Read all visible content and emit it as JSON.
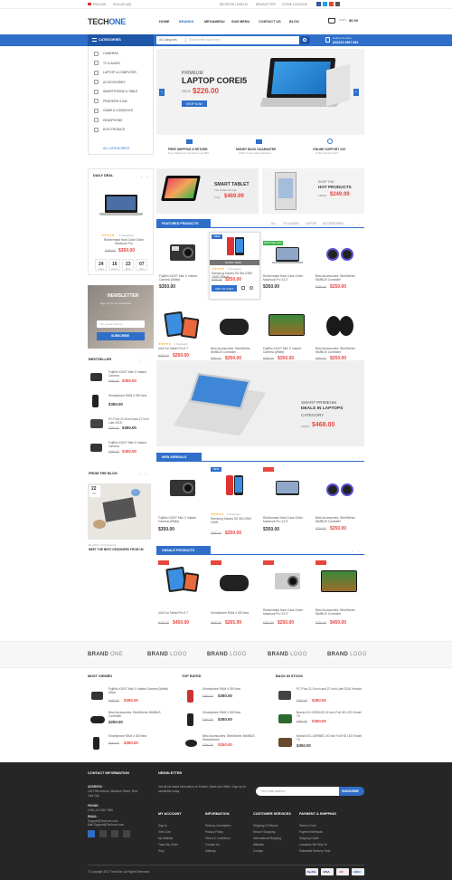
{
  "topbar": {
    "language": "ENGLISH",
    "currency": "DOLLAR (US)",
    "register": "REGISTER | SIGN IN",
    "newsletter": "NEWSLETTER",
    "location": "STORE LOCATION"
  },
  "header": {
    "logo_a": "TECH",
    "logo_b": "ONE",
    "nav": [
      "HOME",
      "BRANDS",
      "MEGAMENU",
      "SUB MENU",
      "CONTACT US",
      "BLOG"
    ],
    "cart_label": "CART",
    "cart_total": "$0.00"
  },
  "searchbar": {
    "categories_label": "CATEGORIES",
    "all_categories": "All Categories",
    "placeholder": "Search entire store here...",
    "hotline_label": "Hotline Number",
    "hotline": "(00)123 4567 891"
  },
  "sidebar_categories": {
    "items": [
      "CAMERAS",
      "TV & AUDIO",
      "LAPTOP & COMPUTER",
      "ACCESSORIES",
      "SMARTPHONE & TABLE",
      "PRINTERS & INK",
      "GAME & CONSOLES",
      "HEADPHONE",
      "ELECTRONICS"
    ],
    "all": "ALL CATEGORIES"
  },
  "hero": {
    "subtitle": "PRIMEUM",
    "title": "LAPTOP COREI5",
    "since": "SINCE",
    "price": "$226.00",
    "cta": "SHOP NOW"
  },
  "services": [
    {
      "title": "FREE SHIPPING & RETURN",
      "desc": "Free shipping on all orders over $99"
    },
    {
      "title": "MONEY BACK GUARANTEE",
      "desc": "100% money back guarantee"
    },
    {
      "title": "ONLINE SUPPORT 24/7",
      "desc": "Online Support 24/7"
    }
  ],
  "daily_deal": {
    "heading": "DAILY DEAL",
    "reviews": "1 Review(s)",
    "name": "Rubbermaid Hard Case Order Macbook Pro",
    "price": "$350.00",
    "old": "$450.00",
    "countdown": [
      {
        "v": "24",
        "l": "Days"
      },
      {
        "v": "16",
        "l": "Hours"
      },
      {
        "v": "23",
        "l": "Mins"
      },
      {
        "v": "07",
        "l": "Secs"
      }
    ]
  },
  "promo_tablet": {
    "title": "SMART TABLET",
    "sub": "The Smart of Look",
    "price_label": "From",
    "price": "$469.99"
  },
  "promo_hot": {
    "line1": "SHOP THE",
    "line2": "HOT PRODUCTS",
    "price_label": "FROM",
    "price": "$249.99"
  },
  "featured": {
    "heading": "FEATURED PRODUCTS",
    "tabs": [
      "ALL",
      "TV & AUDIO",
      "LAPTOP",
      "ACCESSORIES"
    ],
    "quick_view": "QUICK VIEW",
    "add_to_cart": "ADD TO CART",
    "reviews": "1 Review(s)",
    "row1": [
      {
        "name": "Fujifilm X100T Mini X Instant Camera (White)",
        "price": "$350.00",
        "old": ""
      },
      {
        "name": "Samsung Galaxy S5 SM-G900 16GB (Black)",
        "price": "$250.00",
        "old": "$350.00"
      },
      {
        "name": "Rubbermaid Hard Case Order Macbook Pro 13.3\"",
        "price": "$350.00",
        "old": ""
      },
      {
        "name": "Best Accessories: SteelSeries NIMBUS Controller",
        "price": "$250.00",
        "old": "$350.00"
      }
    ],
    "row2": [
      {
        "name": "UAG for Tablet Pro 9.7",
        "price": "$250.00",
        "old": "$350.00"
      },
      {
        "name": "Best Accessories: SteelSeries NIMBUS Controller",
        "price": "$250.00",
        "old": "$350.00"
      },
      {
        "name": "Fujifilm X100T Mini X Instant Camera (White)",
        "price": "$350.00",
        "old": "$450.00"
      },
      {
        "name": "Best Accessories: SteelSeries NIMBUS Controller",
        "price": "$250.00",
        "old": "$350.00"
      }
    ],
    "tags": [
      "NEW",
      "BESTSELLER"
    ]
  },
  "newsletter_box": {
    "title": "NEWSLETTER",
    "text": "Sign up for our newsletter",
    "placeholder": "Your email address",
    "button": "SUBSCRIBE"
  },
  "bestseller": {
    "heading": "BESTSELLER",
    "items": [
      {
        "name": "Fujifilm X100T Mini X Instant Camera",
        "price": "$350.00",
        "old": "$450.00"
      },
      {
        "name": "Smartphone RAM 4 GB New",
        "price": "$350.00",
        "old": ""
      },
      {
        "name": "PC Pros 21.5 inch and 27 inch Late 2015",
        "price": "$350.00",
        "old": "$450.00"
      },
      {
        "name": "Fujifilm X100T Mini X Instant Camera",
        "price": "$350.00",
        "old": "$450.00"
      }
    ]
  },
  "blog": {
    "heading": "FROM THE BLOG",
    "day": "22",
    "month": "JUL",
    "meta": "By Admin | 0 Comments",
    "title": "MEET THE BEST DESIGNERS FROM UK"
  },
  "deals_banner": {
    "line1": "SMART PRIMEUM",
    "line2": "DEALS IN LAPTOPS",
    "line3": "CATEGORY",
    "price_label": "FROM",
    "price": "$468.00"
  },
  "new_arrivals": {
    "heading": "NEW ARRIVALS",
    "reviews": "1 Review(s)",
    "items": [
      {
        "name": "Fujifilm X100T Mini X Instant Camera (White)",
        "price": "$350.00",
        "old": ""
      },
      {
        "name": "Samsung Galaxy S5 SM-G900 16GB",
        "price": "$250.00",
        "old": "$350.00"
      },
      {
        "name": "Rubbermaid Hard Case Order Macbook Pro 13.3\"",
        "price": "$350.00",
        "old": ""
      },
      {
        "name": "Best Accessories: SteelSeries NIMBUS Controller",
        "price": "$250.00",
        "old": "$350.00"
      }
    ]
  },
  "onsale": {
    "heading": "ONSALE PRODUCTS",
    "items": [
      {
        "name": "UAG for Tablet Pro 9.7",
        "price": "$450.00",
        "old": "$750.00"
      },
      {
        "name": "Smartphone RAM 4 GB New",
        "price": "$265.99",
        "old": "$350.00"
      },
      {
        "name": "Rubbermaid Hard Case Order Macbook Pro 13.3\"",
        "price": "$250.00",
        "old": "$350.00"
      },
      {
        "name": "Best Accessories: SteelSeries NIMBUS Controller",
        "price": "$450.00",
        "old": "$750.00"
      }
    ]
  },
  "brands": [
    {
      "a": "BRAND",
      "b": "ONE"
    },
    {
      "a": "BRAND",
      "b": "LOGO"
    },
    {
      "a": "BRAND",
      "b": "LOGO"
    },
    {
      "a": "BRAND",
      "b": "LOGO"
    },
    {
      "a": "BRAND",
      "b": "LOGO"
    },
    {
      "a": "BRAND",
      "b": "LOGO"
    }
  ],
  "lists": {
    "most_viewed": {
      "heading": "MOST VIEWED",
      "items": [
        {
          "name": "Fujifilm X100T Mini X Instant Camera (White) Silver",
          "price": "$350.00",
          "old": "$450.00"
        },
        {
          "name": "Best Accessories: SteelSeries NIMBUS Controller",
          "price": "$250.00",
          "old": ""
        },
        {
          "name": "Smartphone RAM 4 GB New",
          "price": "$350.00",
          "old": "$450.00"
        }
      ]
    },
    "top_rated": {
      "heading": "TOP RATED",
      "items": [
        {
          "name": "Smartphone RAM 4 GB New",
          "price": "$350.00",
          "old": "$450.00"
        },
        {
          "name": "Smartphone RAM 4 GB New",
          "price": "$350.00",
          "old": "$450.00"
        },
        {
          "name": "Best Accessories: SteelSeries NIMBUS Headphones",
          "price": "$250.00",
          "old": "$350.00"
        }
      ]
    },
    "back_in_stock": {
      "heading": "BACK IN STOCK",
      "items": [
        {
          "name": "PC Pros 21.5 inch and 27 inch Late 2015 Version",
          "price": "$350.00",
          "old": "$450.00"
        },
        {
          "name": "Bravia KLV-32R402D 32 inch Full HD LED Smart TV",
          "price": "$350.00",
          "old": "$450.00"
        },
        {
          "name": "Bravia KDL-40R550C 40 inch Full HD LED Smart TV",
          "price": "$350.00",
          "old": ""
        }
      ]
    }
  },
  "footer": {
    "contact_heading": "CONTACT INFORMATION",
    "address_label": "ADDRESS:",
    "address": "123 Fifth Avenue, Madison Street, New York City",
    "phone_label": "PHONE:",
    "phone": "(+84) 123 456 7890",
    "email_label": "EMAIL:",
    "email": "Support@Techone.com",
    "email2": "Mail.Support@Techone.com",
    "newsletter_heading": "NEWSLETTER",
    "newsletter_text": "Get all the latest information on Events, Sales and Offers. Sign up for newsletter today.",
    "newsletter_placeholder": "Your email address",
    "newsletter_button": "SUBSCRIBE",
    "cols": [
      {
        "h": "MY ACCOUNT",
        "links": [
          "Sign In",
          "View Cart",
          "My Wishlist",
          "Track My Order",
          "Help"
        ]
      },
      {
        "h": "INFORMATION",
        "links": [
          "Delivery Information",
          "Privacy Policy",
          "Terms & Conditions",
          "Contact Us",
          "Sitemap"
        ]
      },
      {
        "h": "CUSTOMER SERVICES",
        "links": [
          "Shipping & Returns",
          "Secure Shopping",
          "International Shipping",
          "Affiliates",
          "Contact"
        ]
      },
      {
        "h": "PAYMENT & SHIPPING",
        "links": [
          "Terms of Use",
          "Payment Methods",
          "Shipping Guide",
          "Locations We Ship To",
          "Estimated Delivery Time"
        ]
      }
    ],
    "copyright": "© Copyright 2017 TechOne. All Rights Reserved.",
    "payments": [
      "PayPal",
      "VISA",
      "MC",
      "AMEX"
    ]
  },
  "colors": {
    "accent": "#2f6fc9",
    "sale": "#e8453c",
    "best": "#3bb34a",
    "footer": "#262626"
  }
}
